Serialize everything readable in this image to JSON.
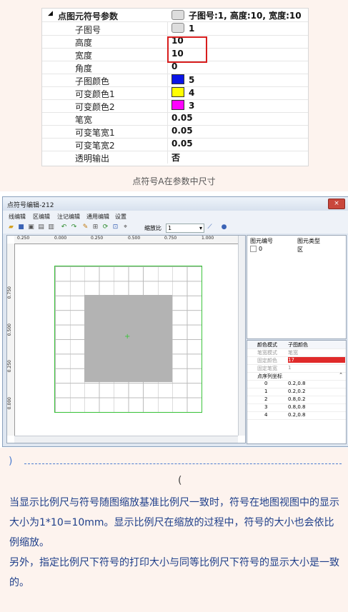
{
  "property_panel": {
    "header_label": "点图元符号参数",
    "header_value": "子图号:1, 高度:10, 宽度:10",
    "rows": [
      {
        "name": "子图号",
        "value": "1"
      },
      {
        "name": "高度",
        "value": "10"
      },
      {
        "name": "宽度",
        "value": "10"
      },
      {
        "name": "角度",
        "value": "0"
      },
      {
        "name": "子图颜色",
        "value": "5"
      },
      {
        "name": "可变颜色1",
        "value": "4"
      },
      {
        "name": "可变颜色2",
        "value": "3"
      },
      {
        "name": "笔宽",
        "value": "0.05"
      },
      {
        "name": "可变笔宽1",
        "value": "0.05"
      },
      {
        "name": "可变笔宽2",
        "value": "0.05"
      },
      {
        "name": "透明输出",
        "value": "否"
      }
    ],
    "colors": {
      "sub": "#0a14e6",
      "var1": "#ffff00",
      "var2": "#ff00ff"
    }
  },
  "caption": "点符号A在参数中尺寸",
  "window": {
    "title": "点符号编辑-212",
    "close": "×",
    "menu": [
      "线编辑",
      "区编辑",
      "注记编辑",
      "通用编辑",
      "设置"
    ],
    "zoom_label": "缩放比",
    "zoom_value": "1",
    "ruler_top": [
      "0.250",
      "0.000",
      "0.250",
      "0.500",
      "0.750",
      "1.000"
    ],
    "ruler_left": [
      "0.750",
      "0.500",
      "0.250",
      "0.000"
    ],
    "list_headers": [
      "图元编号",
      "图元类型"
    ],
    "list_row": {
      "id": "0",
      "type": "区"
    },
    "attr_headers": [
      "颜色模式",
      "子图颜色"
    ],
    "attr_rows": [
      {
        "a": "笔宽模式",
        "b": "笔宽"
      },
      {
        "a": "固定颜色",
        "b": "17"
      },
      {
        "a": "固定笔宽",
        "b": "1"
      }
    ],
    "coord_header": "点序列坐标",
    "coords": [
      {
        "i": "0",
        "v": "0.2,0.8"
      },
      {
        "i": "1",
        "v": "0.2,0.2"
      },
      {
        "i": "2",
        "v": "0.8,0.2"
      },
      {
        "i": "3",
        "v": "0.8,0.8"
      },
      {
        "i": "4",
        "v": "0.2,0.8"
      }
    ]
  },
  "text": {
    "p1": "当显示比例尺与符号随图缩放基准比例尺一致时，符号在地图视图中的显示大小为1*10=10mm。显示比例尺在缩放的过程中，符号的大小也会依比例缩放。",
    "p2": "另外，指定比例尺下符号的打印大小与同等比例尺下符号的显示大小是一致的。",
    "bracket": ")",
    "circle": "("
  }
}
